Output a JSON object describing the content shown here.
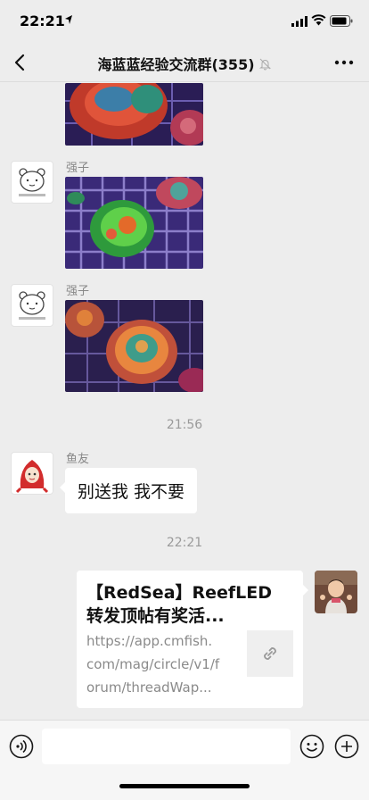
{
  "status_bar": {
    "time": "22:21"
  },
  "nav": {
    "title": "海蓝蓝经验交流群(355)",
    "back_icon": "chevron-left-icon",
    "mute_icon": "bell-slash-icon",
    "more_icon": "ellipsis-icon"
  },
  "messages": {
    "msg1": {
      "sender": "强子",
      "type": "image"
    },
    "msg2": {
      "sender": "强子",
      "type": "image"
    },
    "time1": "21:56",
    "msg3": {
      "sender": "鱼友",
      "text": "别送我 我不要"
    },
    "time2": "22:21",
    "link": {
      "title_line1": "【RedSea】ReefLED",
      "title_line2": "转发顶帖有奖活...",
      "url_line1": "https://app.cmfish.",
      "url_line2": "com/mag/circle/v1/f",
      "url_line3": "orum/threadWap...",
      "thumb_icon": "link-icon"
    }
  },
  "input_bar": {
    "voice_icon": "voice-icon",
    "input_value": "",
    "emoji_icon": "emoji-icon",
    "plus_icon": "plus-icon"
  },
  "colors": {
    "background": "#ededed",
    "bubble": "#ffffff",
    "timestamp": "#9a9a9a",
    "link_desc": "#8a8a8a"
  }
}
